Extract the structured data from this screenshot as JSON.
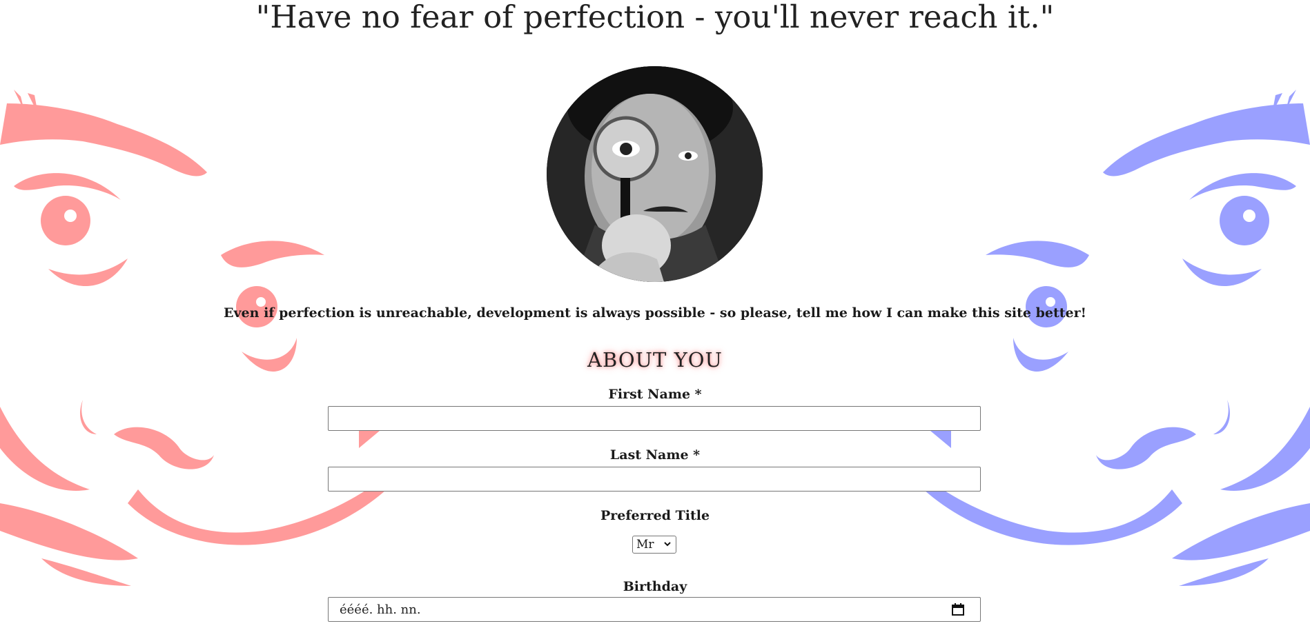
{
  "page": {
    "quote": "\"Have no fear of perfection - you'll never reach it.\"",
    "intro": "Even if perfection is unreachable, development is always possible - so please, tell me how I can make this site better!"
  },
  "portrait": {
    "icon": "portrait-photo"
  },
  "about_section": {
    "title": "ABOUT YOU",
    "accent_glow": "#ff8a8a",
    "first_name": {
      "label": "First Name *",
      "value": ""
    },
    "last_name": {
      "label": "Last Name *",
      "value": ""
    },
    "preferred_title": {
      "label": "Preferred Title",
      "selected": "Mr"
    },
    "birthday": {
      "label": "Birthday",
      "placeholder": "éééé. hh. nn."
    }
  },
  "decoration": {
    "left_color": "#ff9a9a",
    "right_color": "#9aa0ff"
  }
}
